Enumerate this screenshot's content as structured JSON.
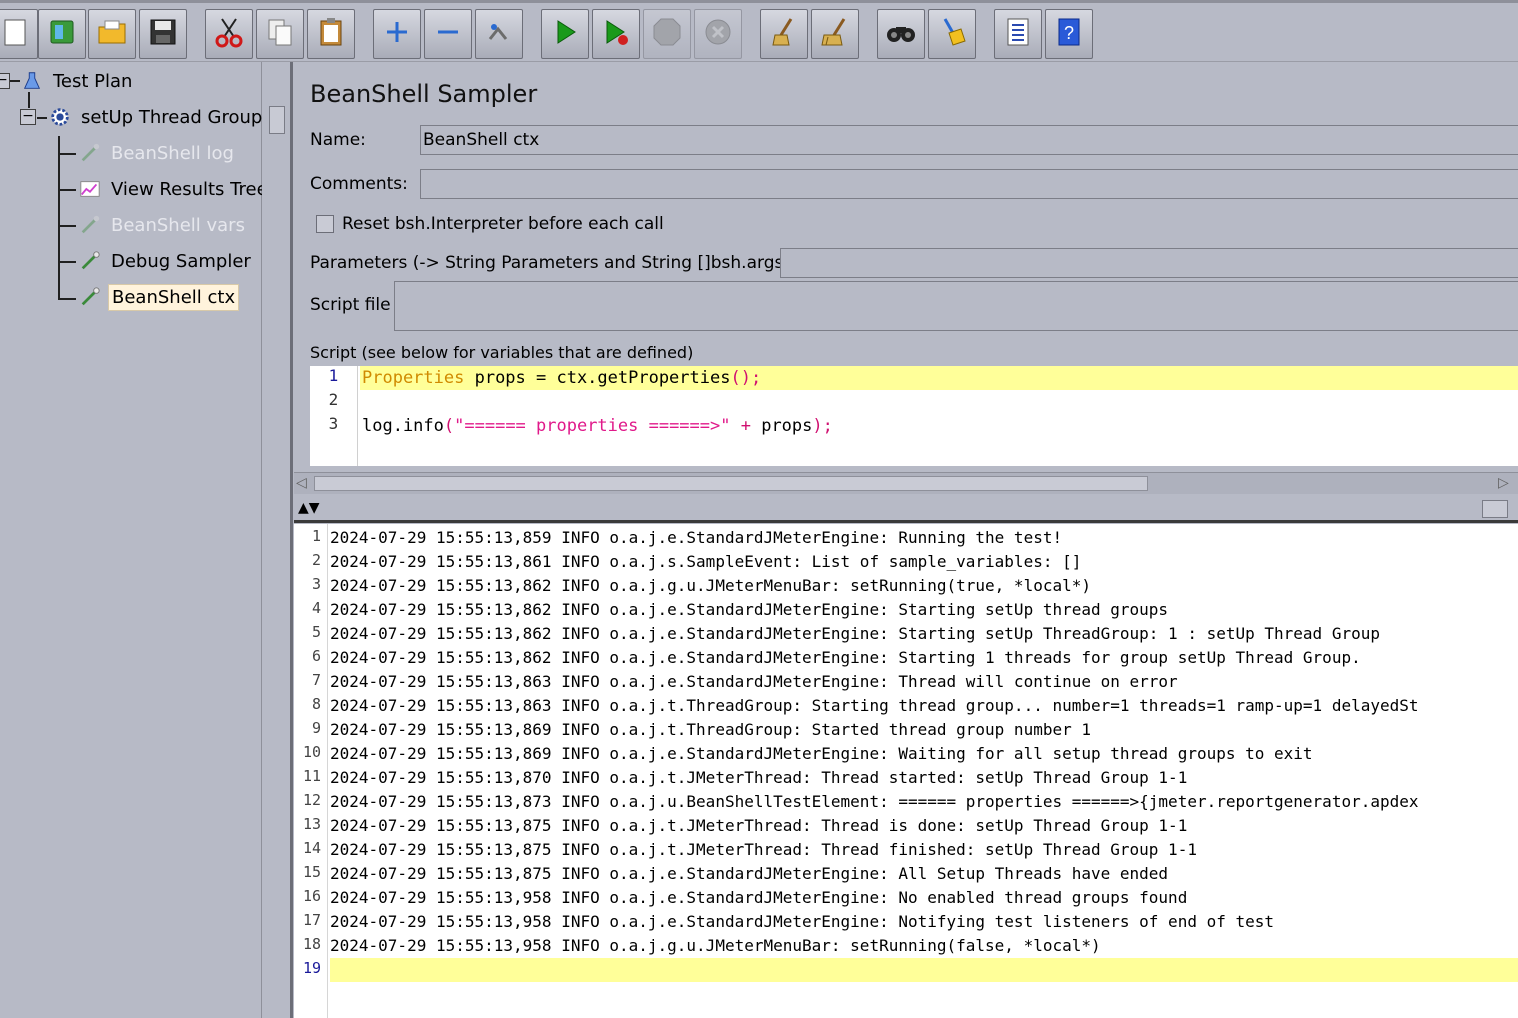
{
  "toolbar": {
    "buttons": [
      {
        "name": "new-icon",
        "glyph": "▭",
        "disabled": false
      },
      {
        "name": "templates-icon",
        "glyph": "📗",
        "disabled": false
      },
      {
        "name": "open-icon",
        "glyph": "📂",
        "disabled": false
      },
      {
        "name": "save-icon",
        "glyph": "💾",
        "disabled": false
      },
      {
        "name": "cut-icon",
        "glyph": "✂",
        "disabled": false
      },
      {
        "name": "copy-icon",
        "glyph": "❐",
        "disabled": false
      },
      {
        "name": "paste-icon",
        "glyph": "📋",
        "disabled": false
      },
      {
        "name": "expand-icon",
        "glyph": "+",
        "disabled": false
      },
      {
        "name": "collapse-icon",
        "glyph": "−",
        "disabled": false
      },
      {
        "name": "toggle-icon",
        "glyph": "⇅",
        "disabled": false
      },
      {
        "name": "start-icon",
        "glyph": "▶",
        "disabled": false
      },
      {
        "name": "start-no-pauses-icon",
        "glyph": "▶",
        "disabled": false
      },
      {
        "name": "stop-icon",
        "glyph": "⬣",
        "disabled": true
      },
      {
        "name": "shutdown-icon",
        "glyph": "✖",
        "disabled": true
      },
      {
        "name": "clear-icon",
        "glyph": "🧹",
        "disabled": false
      },
      {
        "name": "clear-all-icon",
        "glyph": "🧹",
        "disabled": false
      },
      {
        "name": "search-icon",
        "glyph": "🔭",
        "disabled": false
      },
      {
        "name": "reset-search-icon",
        "glyph": "🧹",
        "disabled": false
      },
      {
        "name": "function-helper-icon",
        "glyph": "☰",
        "disabled": false
      },
      {
        "name": "help-icon",
        "glyph": "?",
        "disabled": false
      }
    ]
  },
  "tree": {
    "items": [
      {
        "label": "Test Plan",
        "icon": "flask-icon"
      },
      {
        "label": "setUp Thread Group",
        "icon": "gear-icon"
      },
      {
        "label": "BeanShell log",
        "icon": "pipette-icon",
        "disabled": true
      },
      {
        "label": "View Results Tree",
        "icon": "chart-icon"
      },
      {
        "label": "BeanShell vars",
        "icon": "pipette-icon",
        "disabled": true
      },
      {
        "label": "Debug Sampler",
        "icon": "pipette-icon"
      },
      {
        "label": "BeanShell ctx",
        "icon": "pipette-icon",
        "selected": true
      }
    ]
  },
  "panel": {
    "title": "BeanShell Sampler",
    "name_label": "Name:",
    "name_value": "BeanShell ctx",
    "comments_label": "Comments:",
    "comments_value": "",
    "reset_label": "Reset bsh.Interpreter before each call",
    "parameters_label": "Parameters (-> String Parameters and String []bsh.args)",
    "parameters_value": "",
    "script_file_label": "Script file",
    "script_file_value": "",
    "script_label": "Script (see below for variables that are defined)",
    "script_line_numbers": [
      "1",
      "2",
      "3"
    ],
    "script": {
      "line1_type": "Properties",
      "line1_rest": " props = ctx.getProperties",
      "line1_paren": "();",
      "line3_a": "log.info",
      "line3_paren_open": "(",
      "line3_str": "\"====== properties ======>\"",
      "line3_plus": " + ",
      "line3_var": "props",
      "line3_end": ");"
    }
  },
  "log": {
    "line_numbers": [
      "1",
      "2",
      "3",
      "4",
      "5",
      "6",
      "7",
      "8",
      "9",
      "10",
      "11",
      "12",
      "13",
      "14",
      "15",
      "16",
      "17",
      "18",
      "19"
    ],
    "lines": [
      "2024-07-29 15:55:13,859 INFO o.a.j.e.StandardJMeterEngine: Running the test!",
      "2024-07-29 15:55:13,861 INFO o.a.j.s.SampleEvent: List of sample_variables: []",
      "2024-07-29 15:55:13,862 INFO o.a.j.g.u.JMeterMenuBar: setRunning(true, *local*)",
      "2024-07-29 15:55:13,862 INFO o.a.j.e.StandardJMeterEngine: Starting setUp thread groups",
      "2024-07-29 15:55:13,862 INFO o.a.j.e.StandardJMeterEngine: Starting setUp ThreadGroup: 1 : setUp Thread Group",
      "2024-07-29 15:55:13,862 INFO o.a.j.e.StandardJMeterEngine: Starting 1 threads for group setUp Thread Group.",
      "2024-07-29 15:55:13,863 INFO o.a.j.e.StandardJMeterEngine: Thread will continue on error",
      "2024-07-29 15:55:13,863 INFO o.a.j.t.ThreadGroup: Starting thread group... number=1 threads=1 ramp-up=1 delayedSt",
      "2024-07-29 15:55:13,869 INFO o.a.j.t.ThreadGroup: Started thread group number 1",
      "2024-07-29 15:55:13,869 INFO o.a.j.e.StandardJMeterEngine: Waiting for all setup thread groups to exit",
      "2024-07-29 15:55:13,870 INFO o.a.j.t.JMeterThread: Thread started: setUp Thread Group 1-1",
      "2024-07-29 15:55:13,873 INFO o.a.j.u.BeanShellTestElement: ====== properties ======>{jmeter.reportgenerator.apdex",
      "2024-07-29 15:55:13,875 INFO o.a.j.t.JMeterThread: Thread is done: setUp Thread Group 1-1",
      "2024-07-29 15:55:13,875 INFO o.a.j.t.JMeterThread: Thread finished: setUp Thread Group 1-1",
      "2024-07-29 15:55:13,875 INFO o.a.j.e.StandardJMeterEngine: All Setup Threads have ended",
      "2024-07-29 15:55:13,958 INFO o.a.j.e.StandardJMeterEngine: No enabled thread groups found",
      "2024-07-29 15:55:13,958 INFO o.a.j.e.StandardJMeterEngine: Notifying test listeners of end of test",
      "2024-07-29 15:55:13,958 INFO o.a.j.g.u.JMeterMenuBar: setRunning(false, *local*)",
      ""
    ]
  },
  "colors": {
    "background": "#b7bac6",
    "highlight_line": "#ffff99",
    "selected_tree": "#fff3dc",
    "keyword": "#d08a00",
    "string": "#e0198a"
  }
}
